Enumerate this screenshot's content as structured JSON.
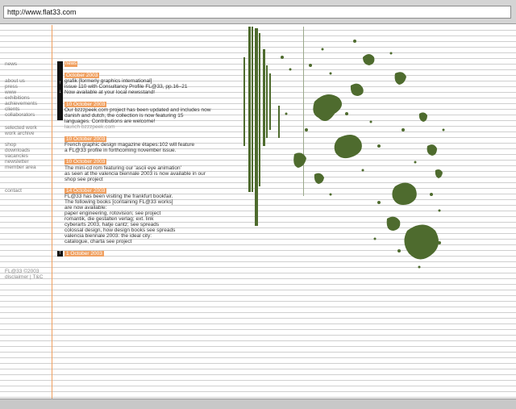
{
  "browser": {
    "url": "http://www.flat33.com"
  },
  "nav": {
    "group1": [
      "news"
    ],
    "group2": [
      "about us",
      "press",
      "www",
      "exhibitions",
      "achievements",
      "clients",
      "collaborators"
    ],
    "group3": [
      "selected work",
      "work archive"
    ],
    "group4": [
      "shop",
      "downloads",
      "vacancies",
      "newsletter",
      "member area"
    ],
    "group5": [
      "contact"
    ]
  },
  "news": {
    "tag": "news",
    "entries": [
      {
        "date": "October 2003",
        "lines": [
          "grafik [formerly graphics international]",
          "issue 110 with Consultancy Profile FL@33, pp.16–21",
          "Now available at your local newsstand!"
        ]
      },
      {
        "date": "10 October 2003",
        "lines": [
          "Our bzzzpeek.com project has been updated and includes now",
          "danish and dutch, the collection is now featuring 15",
          "languages. Contributions are welcome!"
        ],
        "link": "launch bzzzpeek.com"
      },
      {
        "date": "10 October 2003",
        "lines": [
          "French graphic design magazine étapes:102 will feature",
          "a FL@33 profile in forthcoming november issue."
        ]
      },
      {
        "date": "10 October 2003",
        "lines": [
          "The mini-cd rom featuring our 'ascii eye animation'",
          "as seen at the valencia biennale 2003 is now available in our"
        ],
        "link_line": {
          "prefix": "shop",
          "link": "see project"
        }
      },
      {
        "date": "14 October 2003",
        "lines": [
          "FL@33 has been visiting the frankfurt bookfair.",
          "The following books [containing FL@33 works]",
          "are now available:"
        ],
        "books": [
          {
            "text": "paper engineering, rotovision;",
            "link": "see project"
          },
          {
            "text": "romantik, die gestalten verlag; ext. link",
            "link": ""
          },
          {
            "text": "cyberarts 2003, hatje cantz;",
            "link": "see spreads"
          },
          {
            "text": "colossal design, how design books",
            "link": "see spreads"
          },
          {
            "text": "valencia biennale 2003: the ideal city:",
            "link": ""
          },
          {
            "text": "catalogue, charta",
            "link": "see project"
          }
        ]
      }
    ],
    "bottom_date": "1 October 2003"
  },
  "footer": {
    "copyright": "FL@33 ©2003",
    "disclaimer": "disclaimer | T&C"
  },
  "colors": {
    "accent": "#f0a060",
    "map_green": "#4e6b2e"
  }
}
